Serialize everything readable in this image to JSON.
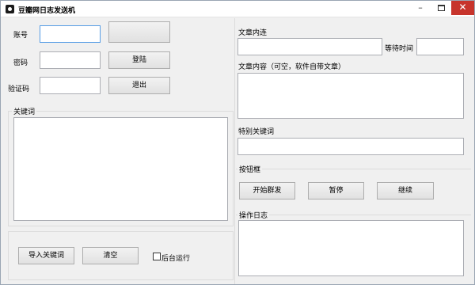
{
  "window": {
    "title": "豆瓣网日志发送机",
    "minimize_glyph": "–",
    "close_glyph": "✕"
  },
  "login": {
    "account_label": "账号",
    "password_label": "密码",
    "captcha_label": "验证码",
    "account_value": "",
    "password_value": "",
    "captcha_value": "",
    "login_button": "登陆",
    "exit_button": "退出"
  },
  "keywords": {
    "group_title": "关键词",
    "import_button": "导入关键词",
    "clear_button": "清空",
    "background_run_label": "后台运行",
    "background_run_checked": false
  },
  "article": {
    "link_label": "文章内连",
    "wait_time_label": "等待时间",
    "content_label": "文章内容（可空，软件自带文章）",
    "special_keywords_label": "特别关键词",
    "link_value": "",
    "wait_time_value": "",
    "content_value": "",
    "special_keywords_value": ""
  },
  "controls": {
    "group_title": "按钮框",
    "start_button": "开始群发",
    "pause_button": "暂停",
    "continue_button": "继续"
  },
  "log": {
    "group_title": "操作日志",
    "value": ""
  },
  "colors": {
    "close_button": "#c7342c",
    "focus_border": "#569de5",
    "window_bg": "#f0f0f0"
  }
}
